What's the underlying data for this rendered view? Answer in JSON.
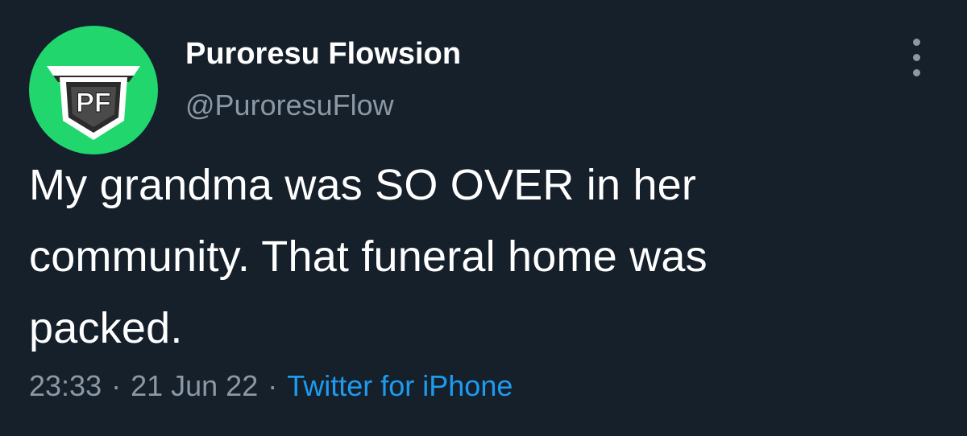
{
  "author": {
    "display_name": "Puroresu Flowsion",
    "handle": "@PuroresuFlow",
    "avatar_icon": "pf-shield-logo",
    "avatar_bg": "#22d66e"
  },
  "menu": {
    "icon": "more-vertical-icon"
  },
  "tweet": {
    "lines": [
      "My grandma was SO OVER in her",
      "community. That funeral home was",
      "packed."
    ]
  },
  "meta": {
    "time": "23:33",
    "separator": "·",
    "date": "21 Jun 22",
    "source": "Twitter for iPhone"
  },
  "colors": {
    "background": "#15202b",
    "primary_text": "#ffffff",
    "secondary_text": "#8b98a5",
    "link": "#1d9bf0"
  }
}
